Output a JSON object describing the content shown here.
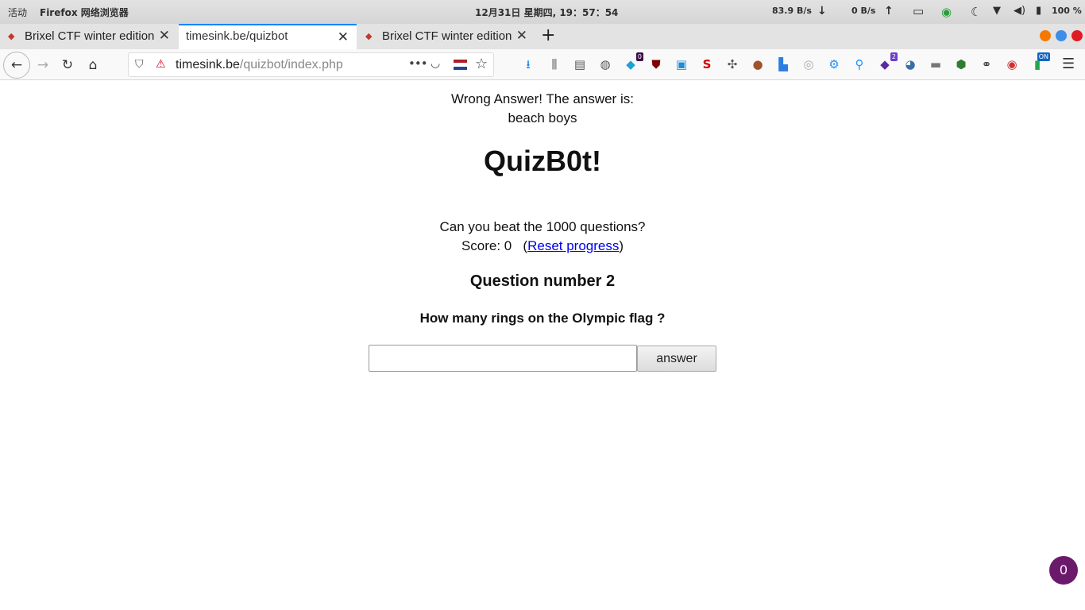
{
  "topbar": {
    "activities": "活动",
    "app_name": "Firefox 网络浏览器",
    "clock": "12月31日 星期四, 19：57：54",
    "net_down": "83.9 B/s",
    "net_up": "0 B/s",
    "battery": "100 %"
  },
  "tabs": [
    {
      "title": "Brixel CTF winter edition",
      "active": false
    },
    {
      "title": "timesink.be/quizbot",
      "active": true
    },
    {
      "title": "Brixel CTF winter edition",
      "active": false
    }
  ],
  "urlbar": {
    "host": "timesink.be",
    "path": "/quizbot/index.php"
  },
  "extensions": {
    "badge_1": "0",
    "badge_2": "2",
    "badge_3": "ON"
  },
  "page": {
    "wrong_line1": "Wrong Answer! The answer is:",
    "wrong_line2": "beach boys",
    "title": "QuizB0t!",
    "intro": "Can you beat the 1000 questions?",
    "score_label": "Score: 0",
    "reset_link": "Reset progress",
    "question_number": "Question number 2",
    "question": "How many rings on the Olympic flag ?",
    "answer_value": "",
    "answer_button": "answer",
    "counter": "0"
  }
}
